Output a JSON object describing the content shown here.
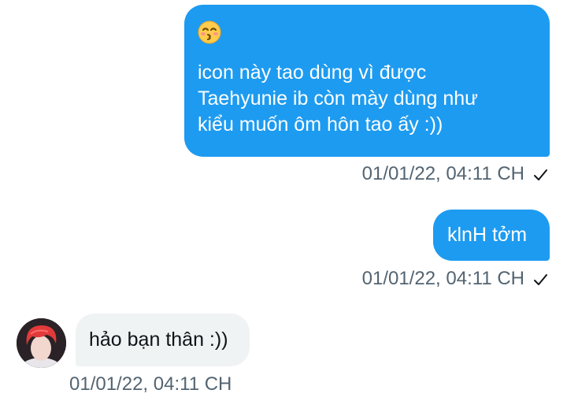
{
  "conversation": {
    "messages": [
      {
        "direction": "sent",
        "emoji": "kissing-face-with-smiling-eyes-emoji",
        "lines": [
          "icon này tao dùng vì được",
          "Taehyunie ib còn mày dùng như",
          "kiểu muốn ôm hôn tao ấy :))"
        ],
        "timestamp": "01/01/22, 04:11 CH",
        "status_icon": "checkmark-icon"
      },
      {
        "direction": "sent",
        "text": "klnH tởm",
        "timestamp": "01/01/22, 04:11 CH",
        "status_icon": "checkmark-icon"
      },
      {
        "direction": "received",
        "text": "hảo bạn thân :))",
        "timestamp": "01/01/22, 04:11 CH",
        "avatar_icon": "profile-avatar"
      }
    ]
  },
  "colors": {
    "sent_bubble": "#1d9bf0",
    "received_bubble": "#eff3f4",
    "meta_text": "#536471"
  }
}
